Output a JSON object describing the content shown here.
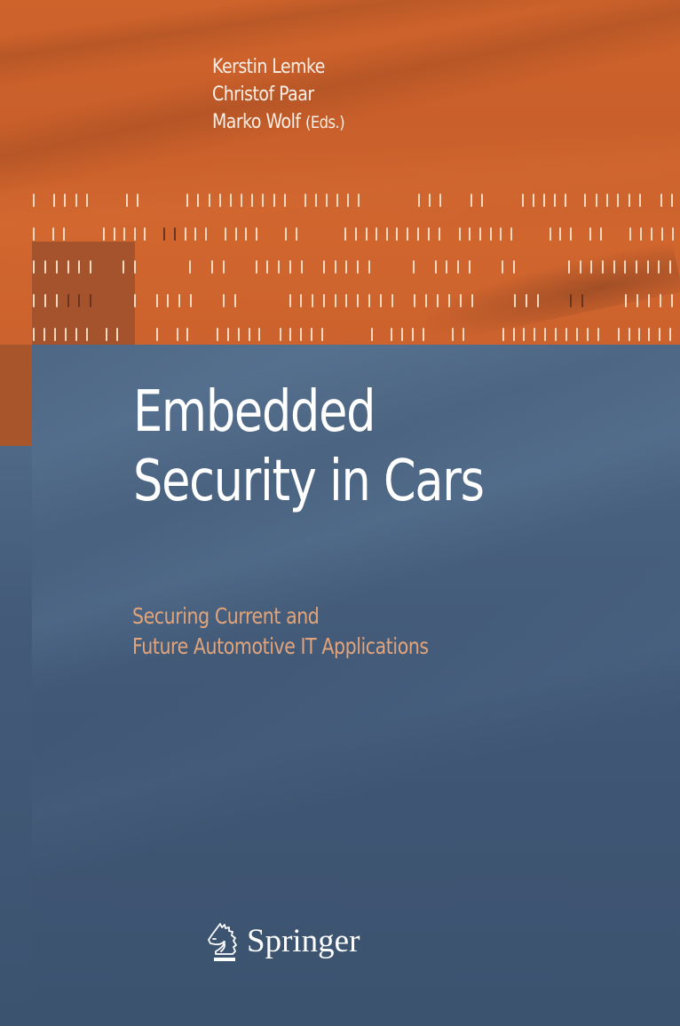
{
  "book": {
    "editors": [
      "Kerstin Lemke",
      "Christof Paar",
      "Marko Wolf"
    ],
    "editors_suffix": "(Eds.)",
    "title_line1": "Embedded",
    "title_line2": "Security in Cars",
    "subtitle_line1": "Securing Current and",
    "subtitle_line2": "Future Automotive IT Applications",
    "publisher": "Springer",
    "publisher_logo_icon": "knight-horse-icon"
  },
  "colors": {
    "top_band": "#cf632c",
    "dark_block": "#a5532c",
    "blue_body": "#465f7d",
    "title_text": "#ffffff",
    "subtitle_text": "#e2a47a",
    "tick_light": "#f6d9bf",
    "tick_dark": "#6a3520"
  },
  "decoration": {
    "tick_rows": [
      {
        "dark_ticks": []
      },
      {
        "dark_ticks": [
          185,
          197
        ]
      },
      {
        "dark_ticks": []
      },
      {
        "dark_ticks": [
          77,
          89,
          102,
          643,
          656
        ]
      },
      {
        "dark_ticks": []
      }
    ]
  }
}
